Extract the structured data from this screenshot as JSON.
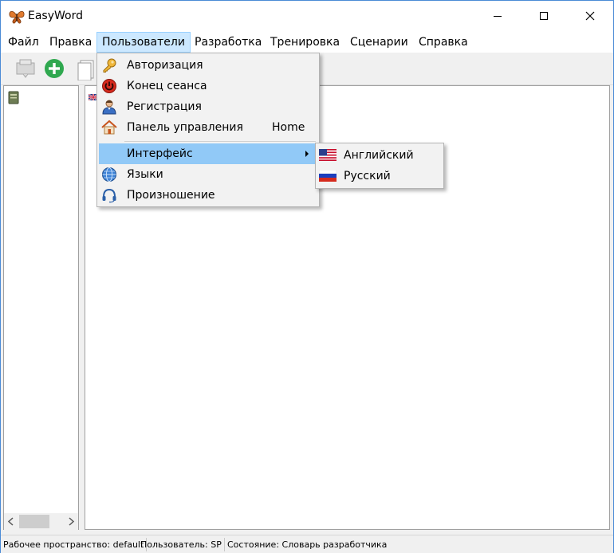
{
  "app": {
    "title": "EasyWord"
  },
  "menubar": [
    {
      "label": "Файл"
    },
    {
      "label": "Правка"
    },
    {
      "label": "Пользователи"
    },
    {
      "label": "Разработка"
    },
    {
      "label": "Тренировка"
    },
    {
      "label": "Сценарии"
    },
    {
      "label": "Справка"
    }
  ],
  "users_menu": {
    "items": [
      {
        "label": "Авторизация",
        "icon": "key-icon"
      },
      {
        "label": "Конец сеанса",
        "icon": "power-icon"
      },
      {
        "label": "Регистрация",
        "icon": "user-icon"
      },
      {
        "label": "Панель управления",
        "shortcut": "Home",
        "icon": "home-icon"
      },
      {
        "label": "Интерфейс",
        "icon": "submenu-arrow-icon",
        "highlighted": true
      },
      {
        "label": "Языки",
        "icon": "globe-icon"
      },
      {
        "label": "Произношение",
        "icon": "headset-icon"
      }
    ]
  },
  "interface_submenu": {
    "items": [
      {
        "label": "Английский",
        "icon": "us-flag-icon"
      },
      {
        "label": "Русский",
        "icon": "russia-flag-icon"
      }
    ]
  },
  "statusbar": {
    "workspace_label": "Рабочее пространство:",
    "workspace_value": "default",
    "user_label": "Пользователь:",
    "user_value": "SP",
    "state_label": "Состояние:",
    "state_value": "Словарь разработчика"
  },
  "colors": {
    "menu_active_bg": "#cce8ff",
    "menu_highlight_bg": "#91c9f7",
    "window_border": "#4a8bd6"
  }
}
